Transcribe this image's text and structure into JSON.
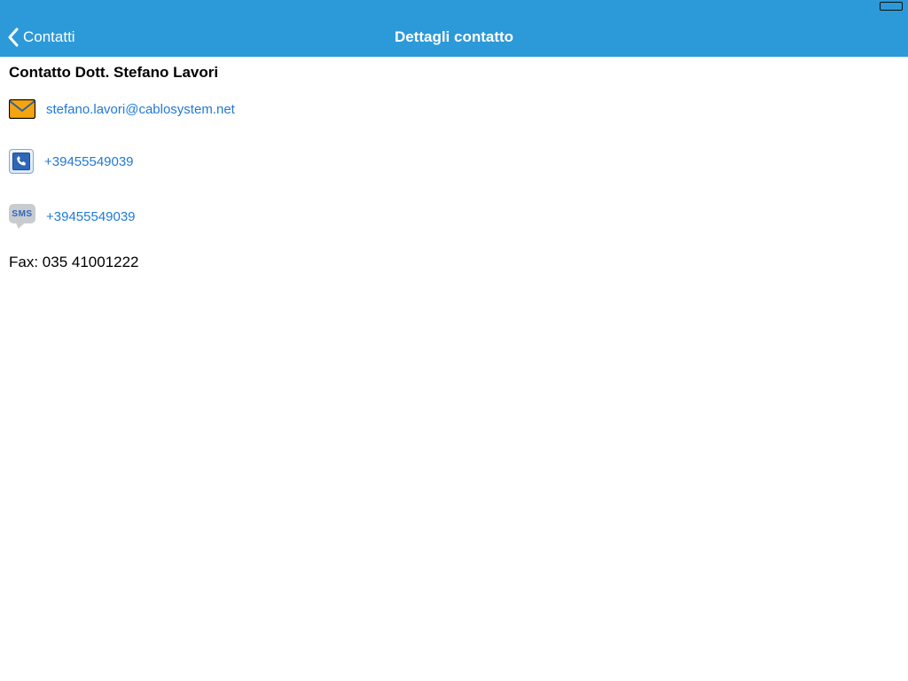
{
  "nav": {
    "back_label": "Contatti",
    "title": "Dettagli contatto"
  },
  "contact": {
    "name": "Contatto Dott. Stefano Lavori",
    "email": "stefano.lavori@cablosystem.net",
    "phone": "+39455549039",
    "sms": "+39455549039",
    "sms_icon_text": "SMS",
    "fax_label": "Fax: 035 41001222"
  }
}
